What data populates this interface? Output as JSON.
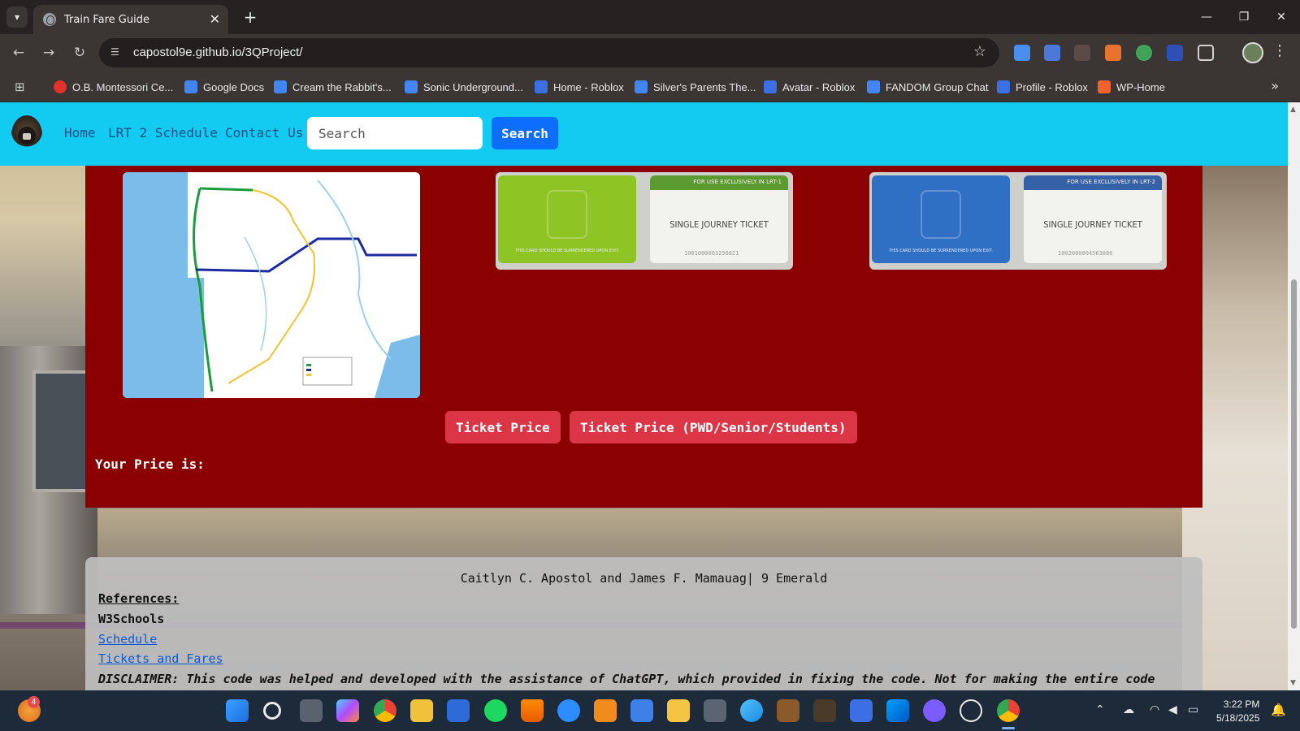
{
  "browser": {
    "tab_title": "Train Fare Guide",
    "tab_close": "✕",
    "new_tab": "+",
    "url": "capostol9e.github.io/3QProject/",
    "window_controls": [
      "—",
      "❐",
      "✕"
    ],
    "bookmarks": [
      {
        "label": "O.B. Montessori Ce...",
        "icon": "montessori-icon",
        "color": "#e0322a"
      },
      {
        "label": "Google Docs",
        "icon": "docs-icon",
        "color": "#4285f4"
      },
      {
        "label": "Cream the Rabbit's...",
        "icon": "docs-icon",
        "color": "#4285f4"
      },
      {
        "label": "Sonic Underground...",
        "icon": "docs-icon",
        "color": "#4285f4"
      },
      {
        "label": "Home - Roblox",
        "icon": "roblox-icon",
        "color": "#3b6fe3"
      },
      {
        "label": "Silver's Parents The...",
        "icon": "docs-icon",
        "color": "#4285f4"
      },
      {
        "label": "Avatar - Roblox",
        "icon": "roblox-icon",
        "color": "#3b6fe3"
      },
      {
        "label": "FANDOM Group Chat",
        "icon": "docs-icon",
        "color": "#4285f4"
      },
      {
        "label": "Profile - Roblox",
        "icon": "roblox-icon",
        "color": "#3b6fe3"
      },
      {
        "label": "WP-Home",
        "icon": "wp-icon",
        "color": "#f2622e"
      }
    ]
  },
  "navbar": {
    "links": [
      "Home",
      "LRT 2 Schedule",
      "Contact Us"
    ],
    "search_placeholder": "Search",
    "search_button": "Search",
    "bg_color": "#13caf0"
  },
  "main": {
    "bg_color": "#8b0000",
    "lrt1_card": {
      "band_text": "FOR USE EXCLUSIVELY IN LRT-1",
      "title": "SINGLE JOURNEY TICKET",
      "number": "1001000003256821",
      "color": "#8fc425",
      "foot": "THIS CARD SHOULD BE SURRENDERED UPON EXIT."
    },
    "lrt2_card": {
      "band_text": "FOR USE EXCLUSIVELY IN LRT-2",
      "title": "SINGLE JOURNEY TICKET",
      "number": "1002000004563886",
      "color": "#2f6fc4",
      "foot": "THIS CARD SHOULD BE SURRENDERED UPON EXIT."
    },
    "buttons": [
      "Ticket Price",
      "Ticket Price (PWD/Senior/Students)"
    ],
    "price_label": "Your Price is:"
  },
  "footer": {
    "credit": "Caitlyn C. Apostol and James F. Mamauag| 9 Emerald",
    "references_heading": "References:",
    "w3schools": "W3Schools",
    "links": [
      "Schedule",
      "Tickets and Fares"
    ],
    "disclaimer": "DISCLAIMER: This code was helped and developed with the assistance of ChatGPT, which provided in fixing the code. Not for making the entire code"
  },
  "taskbar": {
    "weather_badge": "4",
    "time": "3:22 PM",
    "date": "5/18/2025"
  }
}
